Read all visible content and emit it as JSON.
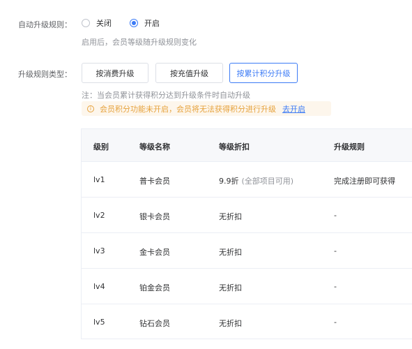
{
  "auto_upgrade": {
    "label": "自动升级规则：",
    "options": [
      {
        "label": "关闭",
        "checked": false
      },
      {
        "label": "开启",
        "checked": true
      }
    ],
    "hint": "启用后，会员等级随升级规则变化"
  },
  "upgrade_type": {
    "label": "升级规则类型：",
    "buttons": [
      {
        "label": "按消费升级",
        "active": false
      },
      {
        "label": "按充值升级",
        "active": false
      },
      {
        "label": "按累计积分升级",
        "active": true
      }
    ],
    "note": "注：当会员累计获得积分达到升级条件时自动升级",
    "warning": {
      "text": "会员积分功能未开启，会员将无法获得积分进行升级",
      "link": "去开启"
    }
  },
  "table": {
    "headers": [
      "级别",
      "等级名称",
      "等级折扣",
      "升级规则"
    ],
    "rows": [
      {
        "level": "lv1",
        "name": "普卡会员",
        "discount": "9.9折",
        "discount_note": "(全部项目可用)",
        "rule": "完成注册即可获得"
      },
      {
        "level": "lv2",
        "name": "银卡会员",
        "discount": "无折扣",
        "discount_note": "",
        "rule": "-"
      },
      {
        "level": "lv3",
        "name": "金卡会员",
        "discount": "无折扣",
        "discount_note": "",
        "rule": "-"
      },
      {
        "level": "lv4",
        "name": "铂金会员",
        "discount": "无折扣",
        "discount_note": "",
        "rule": "-"
      },
      {
        "level": "lv5",
        "name": "钻石会员",
        "discount": "无折扣",
        "discount_note": "",
        "rule": "-"
      }
    ]
  },
  "colors": {
    "primary": "#3c7bf6",
    "warning": "#e6a23c",
    "warning_bg": "#fdf6ec",
    "muted": "#909399"
  }
}
